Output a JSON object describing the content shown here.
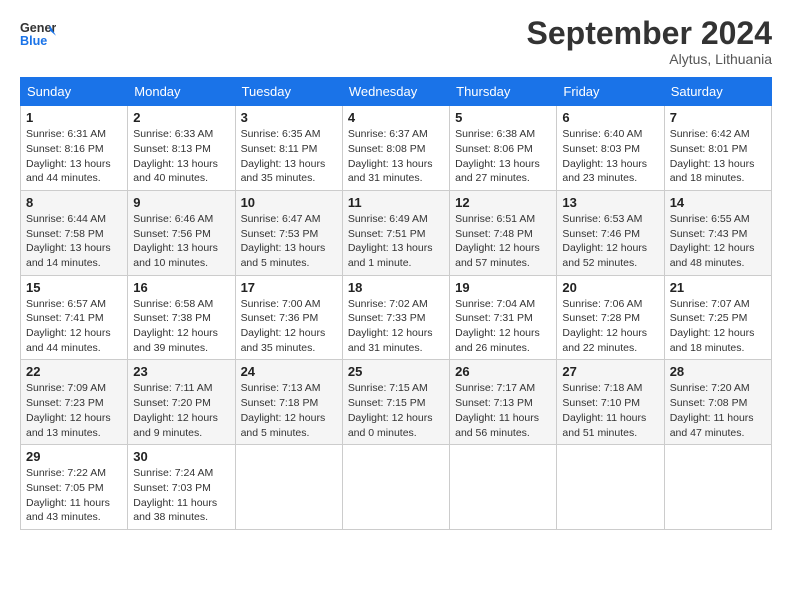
{
  "header": {
    "logo_line1": "General",
    "logo_line2": "Blue",
    "month": "September 2024",
    "location": "Alytus, Lithuania"
  },
  "weekdays": [
    "Sunday",
    "Monday",
    "Tuesday",
    "Wednesday",
    "Thursday",
    "Friday",
    "Saturday"
  ],
  "weeks": [
    [
      {
        "day": "1",
        "info": "Sunrise: 6:31 AM\nSunset: 8:16 PM\nDaylight: 13 hours\nand 44 minutes."
      },
      {
        "day": "2",
        "info": "Sunrise: 6:33 AM\nSunset: 8:13 PM\nDaylight: 13 hours\nand 40 minutes."
      },
      {
        "day": "3",
        "info": "Sunrise: 6:35 AM\nSunset: 8:11 PM\nDaylight: 13 hours\nand 35 minutes."
      },
      {
        "day": "4",
        "info": "Sunrise: 6:37 AM\nSunset: 8:08 PM\nDaylight: 13 hours\nand 31 minutes."
      },
      {
        "day": "5",
        "info": "Sunrise: 6:38 AM\nSunset: 8:06 PM\nDaylight: 13 hours\nand 27 minutes."
      },
      {
        "day": "6",
        "info": "Sunrise: 6:40 AM\nSunset: 8:03 PM\nDaylight: 13 hours\nand 23 minutes."
      },
      {
        "day": "7",
        "info": "Sunrise: 6:42 AM\nSunset: 8:01 PM\nDaylight: 13 hours\nand 18 minutes."
      }
    ],
    [
      {
        "day": "8",
        "info": "Sunrise: 6:44 AM\nSunset: 7:58 PM\nDaylight: 13 hours\nand 14 minutes."
      },
      {
        "day": "9",
        "info": "Sunrise: 6:46 AM\nSunset: 7:56 PM\nDaylight: 13 hours\nand 10 minutes."
      },
      {
        "day": "10",
        "info": "Sunrise: 6:47 AM\nSunset: 7:53 PM\nDaylight: 13 hours\nand 5 minutes."
      },
      {
        "day": "11",
        "info": "Sunrise: 6:49 AM\nSunset: 7:51 PM\nDaylight: 13 hours\nand 1 minute."
      },
      {
        "day": "12",
        "info": "Sunrise: 6:51 AM\nSunset: 7:48 PM\nDaylight: 12 hours\nand 57 minutes."
      },
      {
        "day": "13",
        "info": "Sunrise: 6:53 AM\nSunset: 7:46 PM\nDaylight: 12 hours\nand 52 minutes."
      },
      {
        "day": "14",
        "info": "Sunrise: 6:55 AM\nSunset: 7:43 PM\nDaylight: 12 hours\nand 48 minutes."
      }
    ],
    [
      {
        "day": "15",
        "info": "Sunrise: 6:57 AM\nSunset: 7:41 PM\nDaylight: 12 hours\nand 44 minutes."
      },
      {
        "day": "16",
        "info": "Sunrise: 6:58 AM\nSunset: 7:38 PM\nDaylight: 12 hours\nand 39 minutes."
      },
      {
        "day": "17",
        "info": "Sunrise: 7:00 AM\nSunset: 7:36 PM\nDaylight: 12 hours\nand 35 minutes."
      },
      {
        "day": "18",
        "info": "Sunrise: 7:02 AM\nSunset: 7:33 PM\nDaylight: 12 hours\nand 31 minutes."
      },
      {
        "day": "19",
        "info": "Sunrise: 7:04 AM\nSunset: 7:31 PM\nDaylight: 12 hours\nand 26 minutes."
      },
      {
        "day": "20",
        "info": "Sunrise: 7:06 AM\nSunset: 7:28 PM\nDaylight: 12 hours\nand 22 minutes."
      },
      {
        "day": "21",
        "info": "Sunrise: 7:07 AM\nSunset: 7:25 PM\nDaylight: 12 hours\nand 18 minutes."
      }
    ],
    [
      {
        "day": "22",
        "info": "Sunrise: 7:09 AM\nSunset: 7:23 PM\nDaylight: 12 hours\nand 13 minutes."
      },
      {
        "day": "23",
        "info": "Sunrise: 7:11 AM\nSunset: 7:20 PM\nDaylight: 12 hours\nand 9 minutes."
      },
      {
        "day": "24",
        "info": "Sunrise: 7:13 AM\nSunset: 7:18 PM\nDaylight: 12 hours\nand 5 minutes."
      },
      {
        "day": "25",
        "info": "Sunrise: 7:15 AM\nSunset: 7:15 PM\nDaylight: 12 hours\nand 0 minutes."
      },
      {
        "day": "26",
        "info": "Sunrise: 7:17 AM\nSunset: 7:13 PM\nDaylight: 11 hours\nand 56 minutes."
      },
      {
        "day": "27",
        "info": "Sunrise: 7:18 AM\nSunset: 7:10 PM\nDaylight: 11 hours\nand 51 minutes."
      },
      {
        "day": "28",
        "info": "Sunrise: 7:20 AM\nSunset: 7:08 PM\nDaylight: 11 hours\nand 47 minutes."
      }
    ],
    [
      {
        "day": "29",
        "info": "Sunrise: 7:22 AM\nSunset: 7:05 PM\nDaylight: 11 hours\nand 43 minutes."
      },
      {
        "day": "30",
        "info": "Sunrise: 7:24 AM\nSunset: 7:03 PM\nDaylight: 11 hours\nand 38 minutes."
      },
      {
        "day": "",
        "info": ""
      },
      {
        "day": "",
        "info": ""
      },
      {
        "day": "",
        "info": ""
      },
      {
        "day": "",
        "info": ""
      },
      {
        "day": "",
        "info": ""
      }
    ]
  ]
}
